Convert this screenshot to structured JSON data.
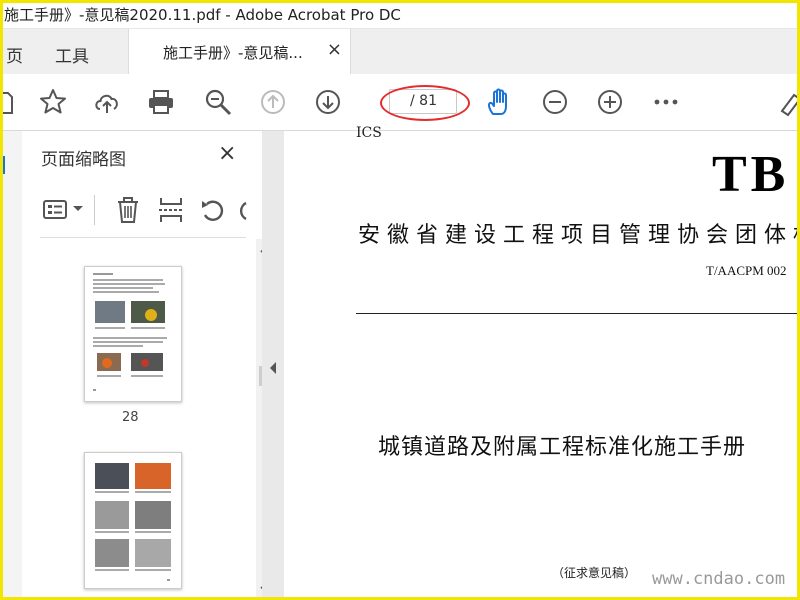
{
  "window": {
    "title": "施工手册》-意见稿2020.11.pdf - Adobe Acrobat Pro DC"
  },
  "menu": {
    "items": [
      "页",
      "工具"
    ]
  },
  "tab": {
    "label": "施工手册》-意见稿...",
    "close": "×"
  },
  "toolbar": {
    "page_count": "/ 81",
    "annotation_color": "#e52b2b",
    "icons": [
      "save-icon",
      "star-icon",
      "upload-cloud-icon",
      "print-icon",
      "zoom-icon",
      "page-up-icon",
      "page-down-icon",
      "hand-tool-icon",
      "zoom-out-icon",
      "zoom-in-icon",
      "more-icon",
      "sign-icon"
    ]
  },
  "sidebar": {
    "title": "页面缩略图",
    "close": "×",
    "tools": [
      "thumbnail-options-icon",
      "delete-page-icon",
      "extract-page-icon",
      "rotate-ccw-icon",
      "rotate-cw-icon"
    ],
    "thumbnails": [
      {
        "page": "28"
      },
      {
        "page": ""
      }
    ]
  },
  "document": {
    "ics": "ICS",
    "big_code": "TB",
    "association": "安徽省建设工程项目管理协会团体标",
    "code": "T/AACPM 002",
    "title": "城镇道路及附属工程标准化施工手册",
    "draft": "（征求意见稿）",
    "watermark": "www.cndao.com"
  }
}
